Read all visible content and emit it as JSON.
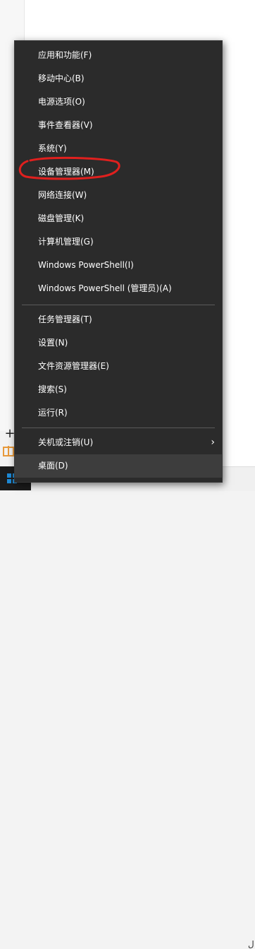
{
  "colors": {
    "menu_bg": "#2b2b2b",
    "menu_text": "#ffffff",
    "separator": "#5a5a5a",
    "highlight": "#3d3d3d",
    "annotation": "#e0201e",
    "windows_blue": "#1e8ad6"
  },
  "taskbar": {
    "start_icon": "windows-logo-icon",
    "tray_glyph": "ل"
  },
  "menu": {
    "group1": [
      {
        "label": "应用和功能(F)"
      },
      {
        "label": "移动中心(B)"
      },
      {
        "label": "电源选项(O)"
      },
      {
        "label": "事件查看器(V)"
      },
      {
        "label": "系统(Y)"
      },
      {
        "label": "设备管理器(M)"
      },
      {
        "label": "网络连接(W)"
      },
      {
        "label": "磁盘管理(K)"
      },
      {
        "label": "计算机管理(G)"
      },
      {
        "label": "Windows PowerShell(I)"
      },
      {
        "label": "Windows PowerShell (管理员)(A)"
      }
    ],
    "group2": [
      {
        "label": "任务管理器(T)"
      },
      {
        "label": "设置(N)"
      },
      {
        "label": "文件资源管理器(E)"
      },
      {
        "label": "搜索(S)"
      },
      {
        "label": "运行(R)"
      }
    ],
    "group3": [
      {
        "label": "关机或注销(U)",
        "submenu_icon": "chevron-right-icon"
      },
      {
        "label": "桌面(D)"
      }
    ]
  }
}
